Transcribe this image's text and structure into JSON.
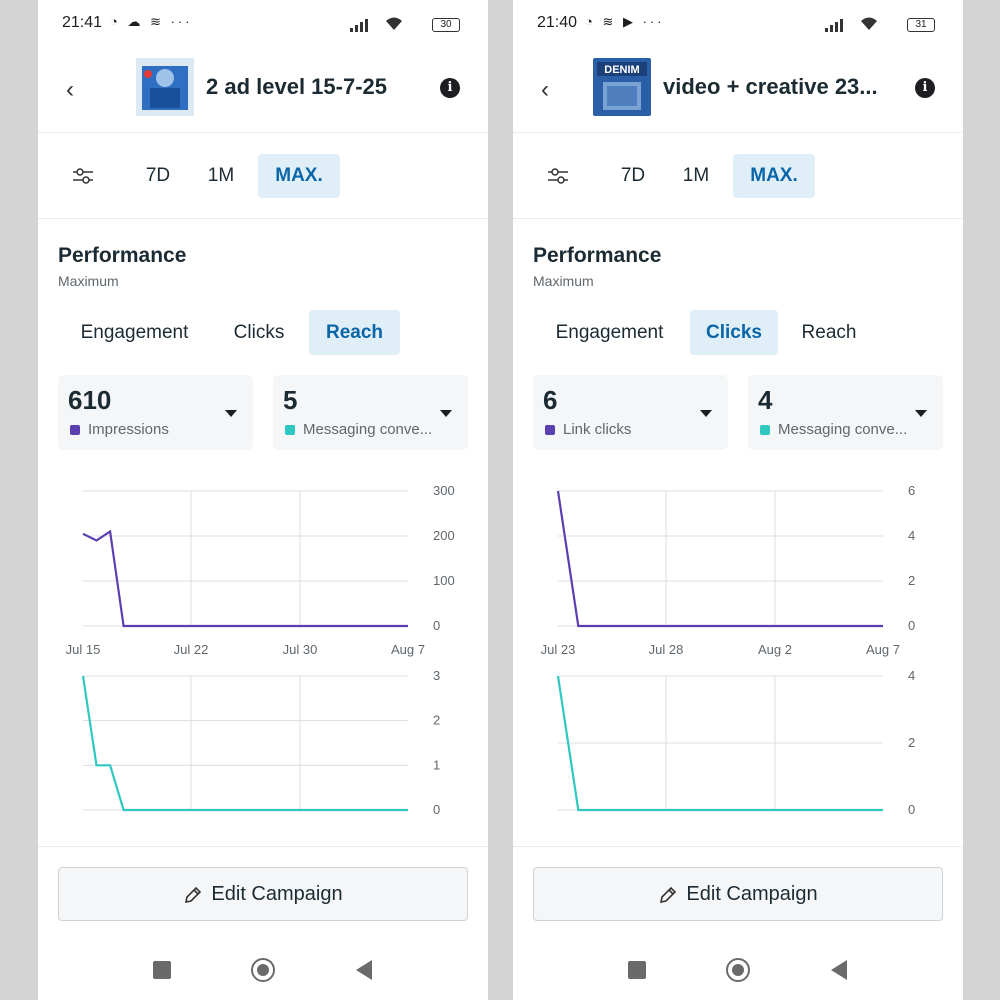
{
  "screens": [
    {
      "status": {
        "time": "21:41",
        "icons": "◔ ☁ ≋  ···",
        "battery": "30"
      },
      "header": {
        "title": "2 ad level 15-7-25",
        "thumbnail_text": ""
      },
      "range_tabs": [
        "7D",
        "1M",
        "MAX."
      ],
      "range_selected": "MAX.",
      "performance": {
        "title": "Performance",
        "subtitle": "Maximum"
      },
      "metric_tabs": [
        "Engagement",
        "Clicks",
        "Reach"
      ],
      "metric_selected": "Reach",
      "cards": [
        {
          "value": "610",
          "label": "Impressions",
          "color": "#5b3fb0"
        },
        {
          "value": "5",
          "label": "Messaging conve...",
          "color": "#2fc8c0"
        }
      ],
      "edit_label": "Edit Campaign",
      "chart_data": [
        {
          "type": "line",
          "series": [
            {
              "name": "Impressions",
              "color": "#5b3fb0",
              "values": [
                205,
                190,
                210,
                0,
                0,
                0,
                0,
                0,
                0,
                0,
                0,
                0,
                0,
                0,
                0,
                0,
                0,
                0,
                0,
                0,
                0,
                0,
                0,
                0,
                0
              ]
            }
          ],
          "x_ticks": [
            "Jul 15",
            "Jul 22",
            "Jul 30",
            "Aug 7"
          ],
          "y_ticks": [
            "300",
            "200",
            "100",
            "0"
          ],
          "ylim": [
            0,
            300
          ]
        },
        {
          "type": "line",
          "series": [
            {
              "name": "Messaging conversations",
              "color": "#2fc8c0",
              "values": [
                3,
                1,
                1,
                0,
                0,
                0,
                0,
                0,
                0,
                0,
                0,
                0,
                0,
                0,
                0,
                0,
                0,
                0,
                0,
                0,
                0,
                0,
                0,
                0,
                0
              ]
            }
          ],
          "y_ticks": [
            "3",
            "2",
            "1",
            "0"
          ],
          "ylim": [
            0,
            3
          ]
        }
      ]
    },
    {
      "status": {
        "time": "21:40",
        "icons": "◔ ≋ ▶  ···",
        "battery": "31"
      },
      "header": {
        "title": "video + creative 23...",
        "thumbnail_text": "DENIM"
      },
      "range_tabs": [
        "7D",
        "1M",
        "MAX."
      ],
      "range_selected": "MAX.",
      "performance": {
        "title": "Performance",
        "subtitle": "Maximum"
      },
      "metric_tabs": [
        "Engagement",
        "Clicks",
        "Reach"
      ],
      "metric_selected": "Clicks",
      "cards": [
        {
          "value": "6",
          "label": "Link clicks",
          "color": "#5b3fb0"
        },
        {
          "value": "4",
          "label": "Messaging conve...",
          "color": "#2fc8c0"
        }
      ],
      "edit_label": "Edit Campaign",
      "chart_data": [
        {
          "type": "line",
          "series": [
            {
              "name": "Link clicks",
              "color": "#5b3fb0",
              "values": [
                6,
                0,
                0,
                0,
                0,
                0,
                0,
                0,
                0,
                0,
                0,
                0,
                0,
                0,
                0,
                0,
                0
              ]
            }
          ],
          "x_ticks": [
            "Jul 23",
            "Jul 28",
            "Aug 2",
            "Aug 7"
          ],
          "y_ticks": [
            "6",
            "4",
            "2",
            "0"
          ],
          "ylim": [
            0,
            6
          ]
        },
        {
          "type": "line",
          "series": [
            {
              "name": "Messaging conversations",
              "color": "#2fc8c0",
              "values": [
                4,
                0,
                0,
                0,
                0,
                0,
                0,
                0,
                0,
                0,
                0,
                0,
                0,
                0,
                0,
                0,
                0
              ]
            }
          ],
          "y_ticks": [
            "4",
            "2",
            "0"
          ],
          "ylim": [
            0,
            4
          ]
        }
      ]
    }
  ]
}
